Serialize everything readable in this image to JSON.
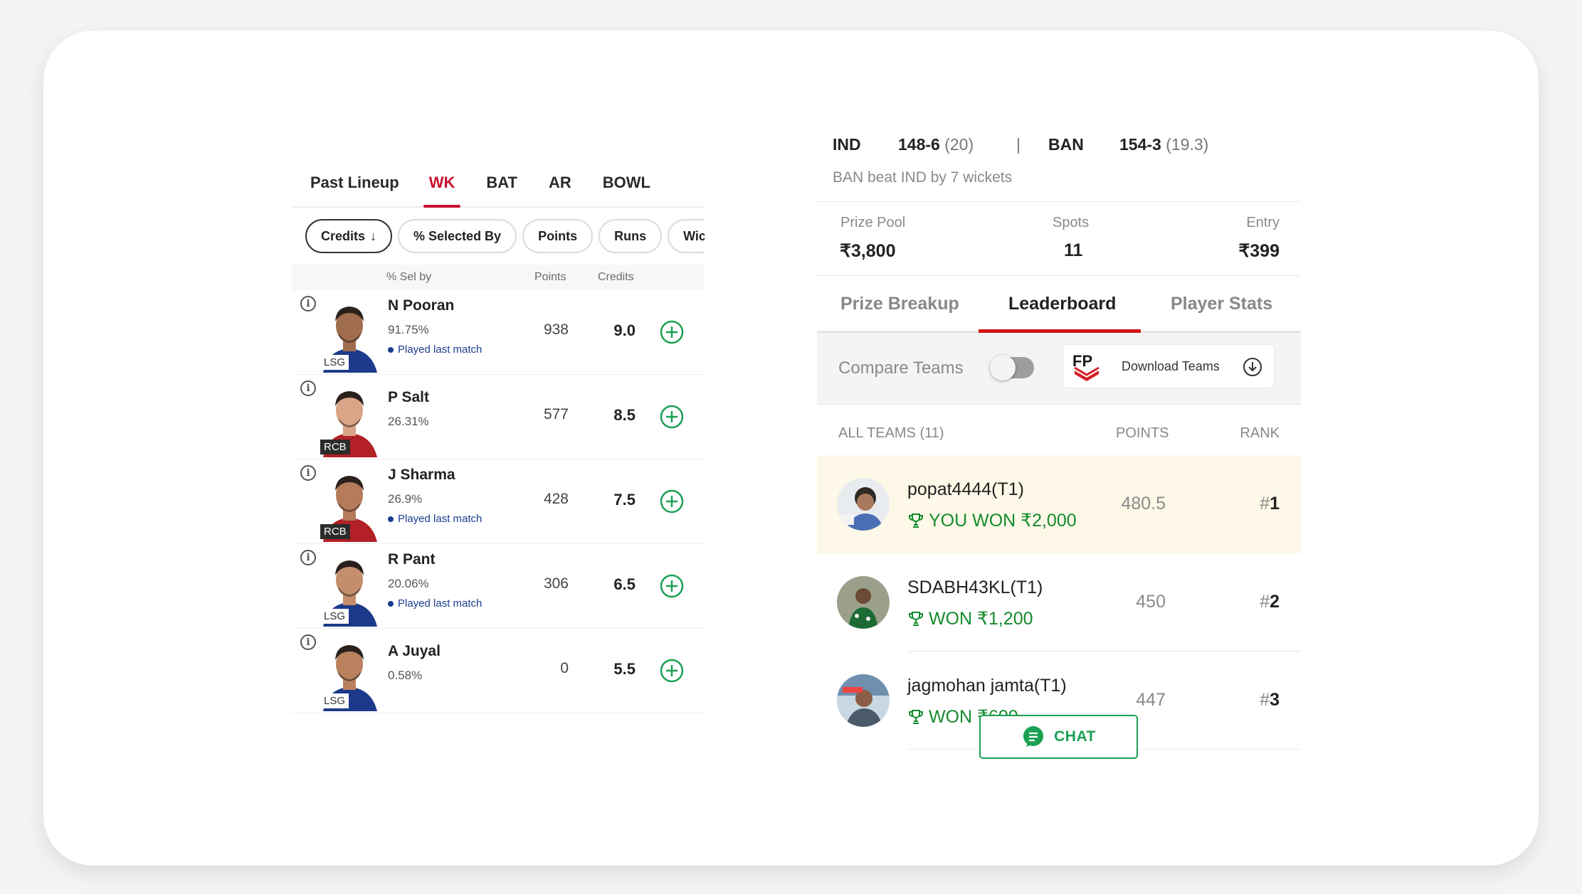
{
  "player_tabs": [
    "Past Lineup",
    "WK",
    "BAT",
    "AR",
    "BOWL"
  ],
  "sort_chips": {
    "credits": "Credits",
    "credits_arrow": "↓",
    "selected_by": "% Selected By",
    "points": "Points",
    "runs": "Runs",
    "wickets": "Wicke"
  },
  "columns": {
    "sel_by": "% Sel by",
    "points": "Points",
    "credits": "Credits"
  },
  "players": [
    {
      "team": "LSG",
      "name": "N Pooran",
      "sel": "91.75%",
      "status": "Played last match",
      "points": "938",
      "credits": "9.0",
      "jersey": "#1d3a8a",
      "skin": "#a06d4e"
    },
    {
      "team": "RCB",
      "name": "P Salt",
      "sel": "26.31%",
      "status": "",
      "points": "577",
      "credits": "8.5",
      "jersey": "#b32025",
      "skin": "#d9a487"
    },
    {
      "team": "RCB",
      "name": "J Sharma",
      "sel": "26.9%",
      "status": "Played last match",
      "points": "428",
      "credits": "7.5",
      "jersey": "#b32025",
      "skin": "#b57b5a"
    },
    {
      "team": "LSG",
      "name": "R Pant",
      "sel": "20.06%",
      "status": "Played last match",
      "points": "306",
      "credits": "6.5",
      "jersey": "#1d3a8a",
      "skin": "#c48e6c"
    },
    {
      "team": "LSG",
      "name": "A Juyal",
      "sel": "0.58%",
      "status": "",
      "points": "0",
      "credits": "5.5",
      "jersey": "#1d3a8a",
      "skin": "#b9815e"
    }
  ],
  "match": {
    "team1": "IND",
    "score1": "148-6",
    "overs1": "(20)",
    "divider": "|",
    "team2": "BAN",
    "score2": "154-3",
    "overs2": "(19.3)",
    "result": "BAN beat IND by 7 wickets"
  },
  "contest": {
    "prize_label": "Prize Pool",
    "prize_value": "₹3,800",
    "spots_label": "Spots",
    "spots_value": "11",
    "entry_label": "Entry",
    "entry_value": "₹399"
  },
  "result_tabs": [
    "Prize Breakup",
    "Leaderboard",
    "Player Stats"
  ],
  "compare": {
    "label": "Compare Teams",
    "download": "Download Teams",
    "toggle_on": false
  },
  "leaderboard_header": {
    "teams": "ALL TEAMS (11)",
    "points": "POINTS",
    "rank": "RANK"
  },
  "leaderboard": [
    {
      "name": "popat4444(T1)",
      "won": "YOU WON ₹2,000",
      "points": "480.5",
      "rank_hash": "#",
      "rank": "1"
    },
    {
      "name": "SDABH43KL(T1)",
      "won": "WON ₹1,200",
      "points": "450",
      "rank_hash": "#",
      "rank": "2"
    },
    {
      "name": "jagmohan jamta(T1)",
      "won": "WON ₹600",
      "points": "447",
      "rank_hash": "#",
      "rank": "3"
    }
  ],
  "chat": {
    "label": "CHAT"
  },
  "colors": {
    "accent_red": "#c8102e",
    "tab_underline": "#d11313",
    "won_green": "#148a2d",
    "add_green": "#1aa053",
    "winner_bg": "#fdf8e7"
  }
}
